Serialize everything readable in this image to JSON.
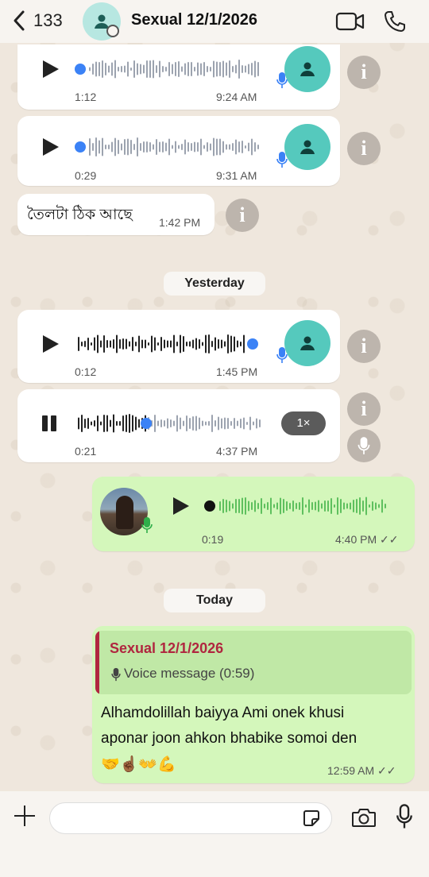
{
  "header": {
    "back_count": "133",
    "title": "Sexual 12/1/2026"
  },
  "messages": [
    {
      "type": "voice",
      "direction": "in",
      "duration": "1:12",
      "time": "9:24 AM"
    },
    {
      "type": "voice",
      "direction": "in",
      "duration": "0:29",
      "time": "9:31 AM"
    },
    {
      "type": "text",
      "direction": "in",
      "text": "তৈলটা ঠিক আছে",
      "time": "1:42 PM"
    },
    {
      "type": "voice",
      "direction": "in",
      "duration": "0:12",
      "time": "1:45 PM"
    },
    {
      "type": "voice",
      "direction": "in",
      "state": "playing",
      "duration": "0:21",
      "time": "4:37 PM",
      "speed": "1×"
    },
    {
      "type": "voice",
      "direction": "out",
      "duration": "0:19",
      "time": "4:40 PM ✓✓"
    },
    {
      "type": "reply-text",
      "direction": "out",
      "reply_name": "Sexual 12/1/2026",
      "reply_text": "Voice message (0:59)",
      "text_line1": "Alhamdolillah baiyya Ami onek khusi",
      "text_line2": "aponar joon ahkon bhabike somoi den",
      "emojis": "🤝☝🏾👐💪",
      "time": "12:59 AM ✓✓"
    }
  ],
  "date_chips": {
    "yesterday": "Yesterday",
    "today": "Today"
  },
  "composer": {
    "placeholder": ""
  },
  "colors": {
    "accent_teal": "#55c9bd",
    "outgoing_bubble": "#d4f7bb",
    "voice_dot": "#3b82f6",
    "reply_bar": "#b0263f"
  }
}
